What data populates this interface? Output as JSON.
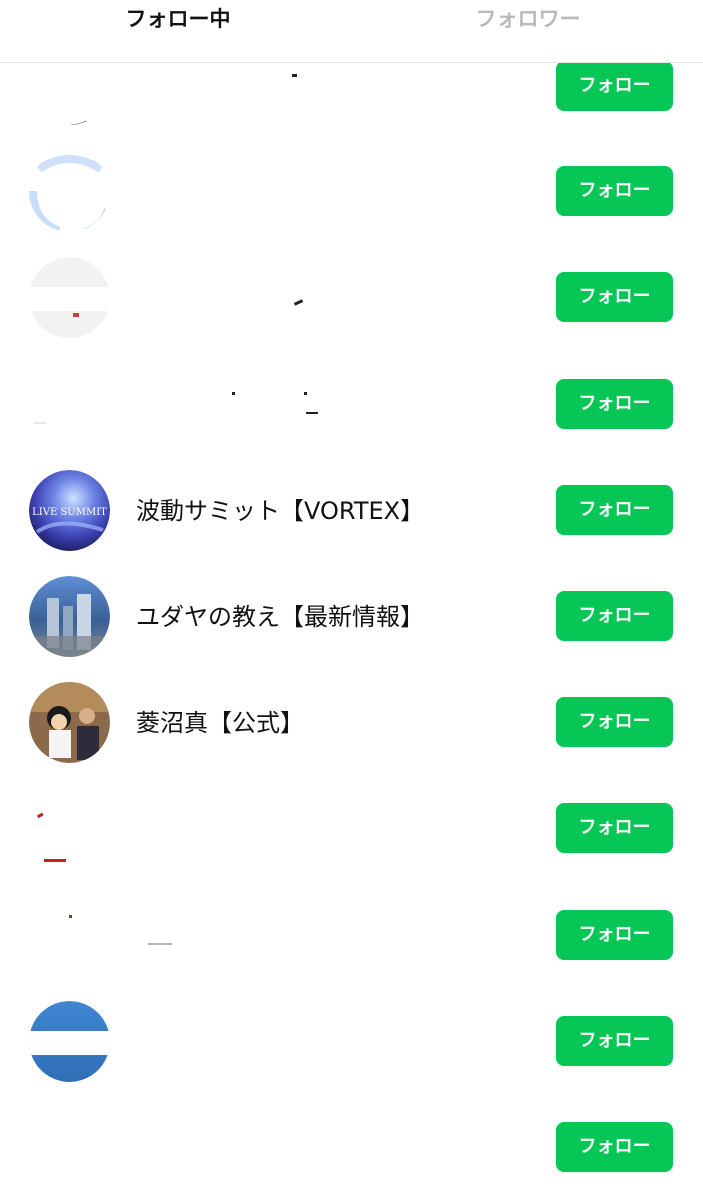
{
  "tabs": [
    {
      "label": "フォロー中",
      "active": true
    },
    {
      "label": "フォロワー",
      "active": false
    }
  ],
  "follow_label": "フォロー",
  "accounts": [
    {
      "name": ""
    },
    {
      "name": ""
    },
    {
      "name": ""
    },
    {
      "name": ""
    },
    {
      "name": "波動サミット【VORTEX】"
    },
    {
      "name": "ユダヤの教え【最新情報】"
    },
    {
      "name": "菱沼真【公式】"
    },
    {
      "name": ""
    },
    {
      "name": ""
    },
    {
      "name": ""
    },
    {
      "name": ""
    }
  ],
  "colors": {
    "follow_button": "#06c755",
    "active_tab_text": "#111111",
    "inactive_tab_text": "#b9b9b9"
  }
}
